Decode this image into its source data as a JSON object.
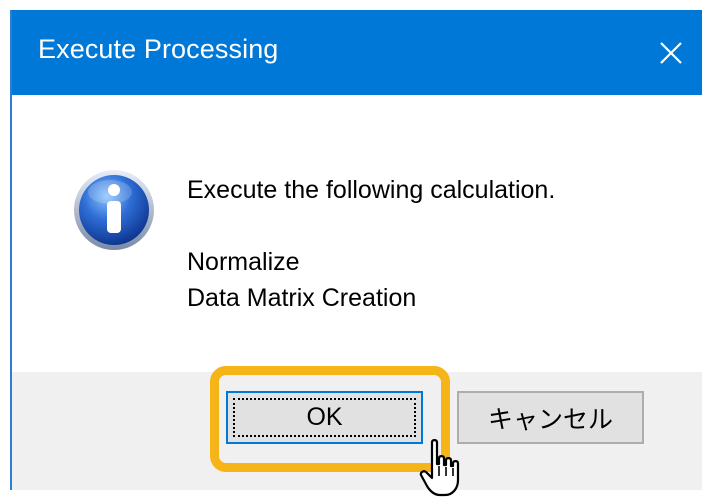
{
  "dialog": {
    "title": "Execute Processing",
    "message_line1": "Execute the following calculation.",
    "message_line2": "Normalize",
    "message_line3": "Data Matrix Creation"
  },
  "buttons": {
    "ok_label": "OK",
    "cancel_label": "キャンセル"
  },
  "icons": {
    "info": "info-icon",
    "close": "close-icon",
    "cursor": "hand-pointer-icon"
  },
  "colors": {
    "titlebar": "#0078d7",
    "highlight": "#f5b417",
    "footer": "#f0f0f0"
  }
}
